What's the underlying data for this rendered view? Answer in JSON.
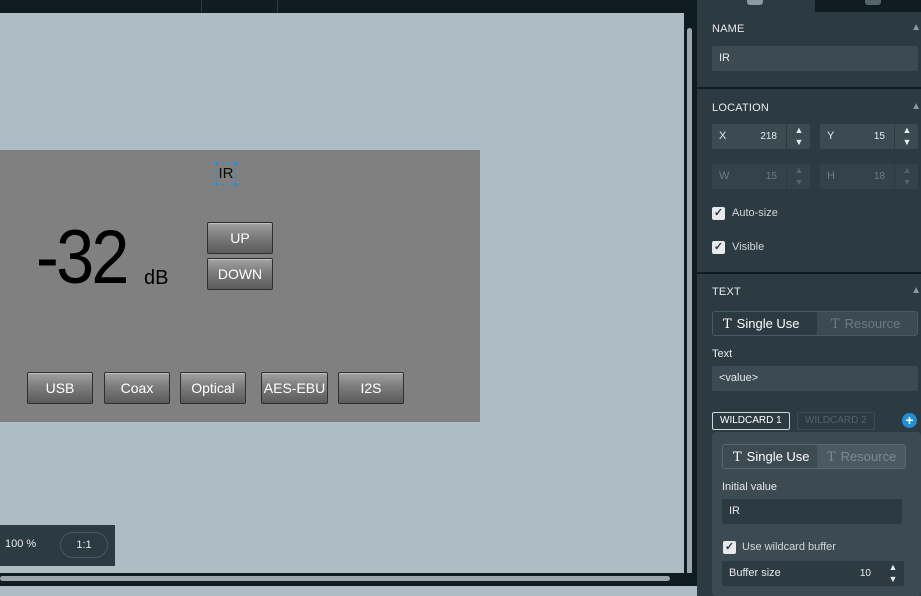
{
  "canvas": {
    "widget": {
      "ir_label": "IR",
      "value": "-32",
      "unit": "dB",
      "up_label": "UP",
      "down_label": "DOWN",
      "inputs": [
        "USB",
        "Coax",
        "Optical",
        "AES-EBU",
        "I2S"
      ]
    },
    "zoom": {
      "percent": "100 %",
      "ratio_label": "1:1"
    }
  },
  "panel": {
    "name": {
      "title": "NAME",
      "value": "IR"
    },
    "location": {
      "title": "LOCATION",
      "x_label": "X",
      "x_value": "218",
      "y_label": "Y",
      "y_value": "15",
      "w_label": "W",
      "w_value": "15",
      "h_label": "H",
      "h_value": "18",
      "autosize_label": "Auto-size",
      "visible_label": "Visible"
    },
    "text": {
      "title": "TEXT",
      "single_use": "Single Use",
      "resource": "Resource",
      "text_label": "Text",
      "text_value": "<value>",
      "wildcard1": "WILDCARD 1",
      "wildcard2": "WILDCARD 2",
      "wc_single_use": "Single Use",
      "wc_resource": "Resource",
      "initial_value_label": "Initial value",
      "initial_value": "IR",
      "use_buffer_label": "Use wildcard buffer",
      "buffer_size_label": "Buffer size",
      "buffer_size": "10"
    },
    "icons": {
      "glyph_t": "T",
      "check": "✓",
      "up": "▲",
      "down": "▼",
      "collapse": "▲",
      "plus": "+"
    }
  },
  "colors": {
    "accent": "#1e90d8",
    "canvas_bg": "#aebdc3",
    "panel_bg": "#2c3a41",
    "widget_bg": "#808080"
  }
}
